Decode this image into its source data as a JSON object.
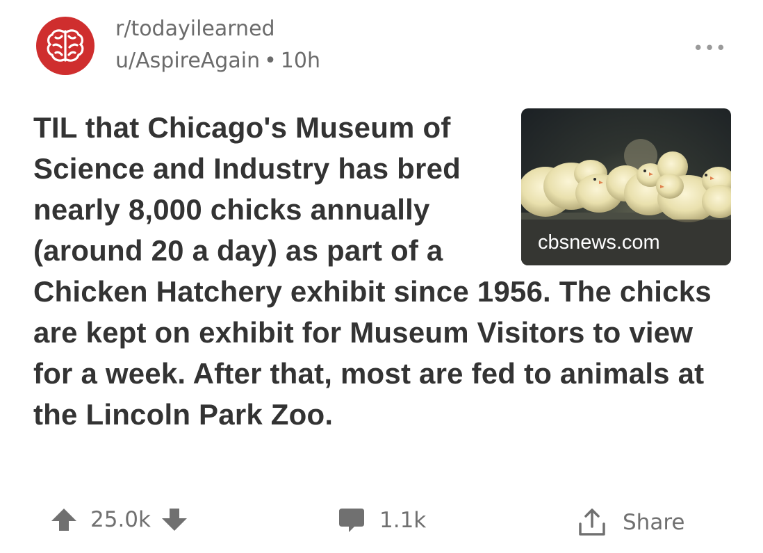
{
  "post": {
    "subreddit": "r/todayilearned",
    "author": "u/AspireAgain",
    "separator": "•",
    "age": "10h",
    "more_label": "•••",
    "title": "TIL that Chicago's Museum of Science and Industry has bred nearly 8,000 chicks annually (around 20 a day) as part of a Chicken Hatchery exhibit since 1956. The chicks are kept on exhibit for Museum Visitors to view for a week. After that, most are fed to animals at the Lincoln Park Zoo.",
    "thumbnail": {
      "domain": "cbsnews.com",
      "image": "chicks-photo"
    }
  },
  "actions": {
    "score": "25.0k",
    "comments": "1.1k",
    "share": "Share"
  },
  "colors": {
    "accent": "#cf2e2e",
    "meta_text": "#6b6b6b",
    "title_text": "#333333",
    "action_text": "#707070"
  },
  "icons": [
    "brain-icon",
    "more-icon",
    "upvote-icon",
    "downvote-icon",
    "comment-icon",
    "share-icon"
  ]
}
